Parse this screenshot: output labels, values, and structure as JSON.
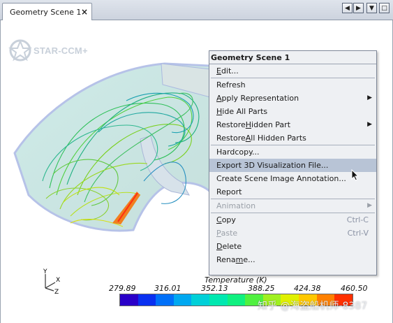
{
  "tab": {
    "title": "Geometry Scene 1",
    "close_glyph": "×"
  },
  "tab_controls": {
    "left": "◀",
    "right": "▶",
    "down": "▼",
    "restore": "□"
  },
  "logo": {
    "text": "STAR-CCM+"
  },
  "axes": {
    "x": "X",
    "y": "Y",
    "z": "Z"
  },
  "colorbar": {
    "title": "Temperature (K)",
    "ticks": [
      "279.89",
      "316.01",
      "352.13",
      "388.25",
      "424.38",
      "460.50"
    ],
    "colors": [
      "#2a00c8",
      "#0a30f0",
      "#0070f8",
      "#00a8f0",
      "#00d0d8",
      "#00e8b0",
      "#10f080",
      "#50f040",
      "#a0f020",
      "#e0f000",
      "#ffc800",
      "#ff8000",
      "#ff3000"
    ]
  },
  "watermark": "知乎 @海盗船机师-8387",
  "menu": {
    "title": "Geometry Scene 1",
    "items": [
      {
        "pre": "",
        "u": "E",
        "post": "dit...",
        "arrow": ""
      },
      {
        "pre": "Refresh",
        "u": "",
        "post": "",
        "arrow": ""
      },
      {
        "pre": "",
        "u": "A",
        "post": "pply Representation",
        "arrow": "▶"
      },
      {
        "pre": "",
        "u": "H",
        "post": "ide All Parts",
        "arrow": ""
      },
      {
        "pre": "Restore ",
        "u": "H",
        "post": "idden Part",
        "arrow": "▶"
      },
      {
        "pre": "Restore ",
        "u": "A",
        "post": "ll Hidden Parts",
        "arrow": ""
      },
      {
        "pre": "Hardcopy...",
        "u": "",
        "post": "",
        "arrow": ""
      },
      {
        "pre": "Export 3D Visualization File...",
        "u": "",
        "post": "",
        "arrow": ""
      },
      {
        "pre": "Create Scene Image Annotation...",
        "u": "",
        "post": "",
        "arrow": ""
      },
      {
        "pre": "Report",
        "u": "",
        "post": "",
        "arrow": ""
      },
      {
        "pre": "Animation",
        "u": "",
        "post": "",
        "arrow": "▶"
      },
      {
        "pre": "",
        "u": "C",
        "post": "opy",
        "shortcut": "Ctrl-C"
      },
      {
        "pre": "",
        "u": "P",
        "post": "aste",
        "shortcut": "Ctrl-V"
      },
      {
        "pre": "",
        "u": "D",
        "post": "elete",
        "shortcut": ""
      },
      {
        "pre": "Rena",
        "u": "m",
        "post": "e...",
        "shortcut": ""
      }
    ]
  }
}
